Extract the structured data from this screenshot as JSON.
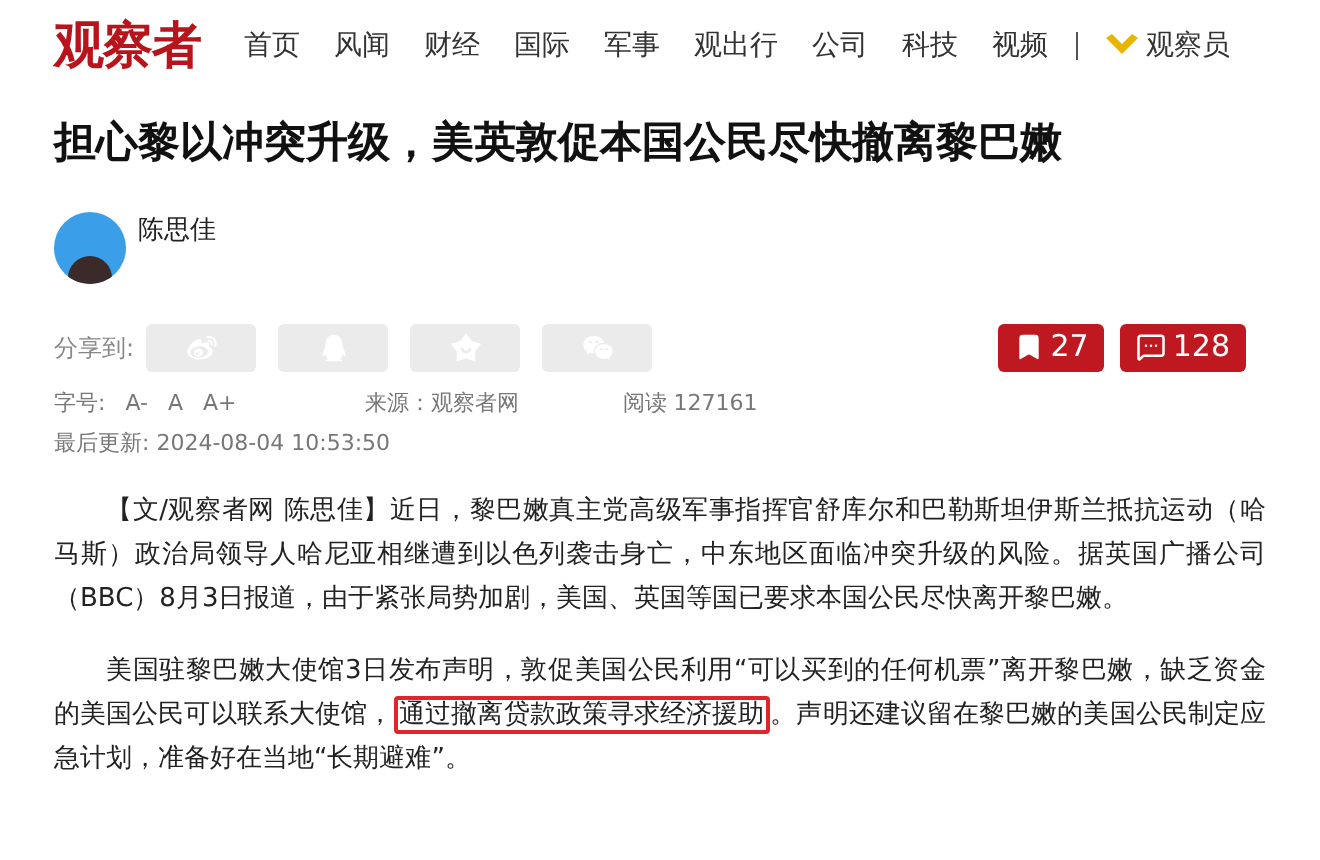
{
  "header": {
    "logo": "观察者",
    "nav": [
      {
        "label": "首页"
      },
      {
        "label": "风闻"
      },
      {
        "label": "财经"
      },
      {
        "label": "国际"
      },
      {
        "label": "军事"
      },
      {
        "label": "观出行"
      },
      {
        "label": "公司"
      },
      {
        "label": "科技"
      },
      {
        "label": "视频"
      }
    ],
    "member_link": "观察员"
  },
  "article": {
    "title": "担心黎以冲突升级，美英敦促本国公民尽快撤离黎巴嫩",
    "author": "陈思佳",
    "share_label": "分享到:",
    "share_buttons": [
      {
        "kind": "weibo"
      },
      {
        "kind": "qq"
      },
      {
        "kind": "star"
      },
      {
        "kind": "wechat"
      }
    ],
    "actions": [
      {
        "kind": "bookmark",
        "count": "27"
      },
      {
        "kind": "comment",
        "count": "128"
      }
    ],
    "font_size_label": "字号:",
    "font_sizes": [
      "A-",
      "A",
      "A+"
    ],
    "source": "来源：观察者网",
    "reads": "阅读 127161",
    "updated": "最后更新: 2024-08-04 10:53:50",
    "paragraphs": [
      [
        {
          "text": "【文/观察者网 陈思佳】近日，黎巴嫩真主党高级军事指挥官舒库尔和巴勒斯坦伊斯兰抵抗运动（哈马斯）政治局领导人哈尼亚相继遭到以色列袭击身亡，中东地区面临冲突升级的风险。据英国广播公司（BBC）8月3日报道，由于紧张局势加剧，美国、英国等国已要求本国公民尽快离开黎巴嫩。",
          "highlighted": false
        }
      ],
      [
        {
          "text": "美国驻黎巴嫩大使馆3日发布声明，敦促美国公民利用“可以买到的任何机票”离开黎巴嫩，缺乏资金的美国公民可以联系大使馆，",
          "highlighted": false
        },
        {
          "text": "通过撤离贷款政策寻求经济援助",
          "highlighted": true
        },
        {
          "text": "。声明还建议留在黎巴嫩的美国公民制定应急计划，准备好在当地“长期避难”。",
          "highlighted": false
        }
      ]
    ]
  }
}
